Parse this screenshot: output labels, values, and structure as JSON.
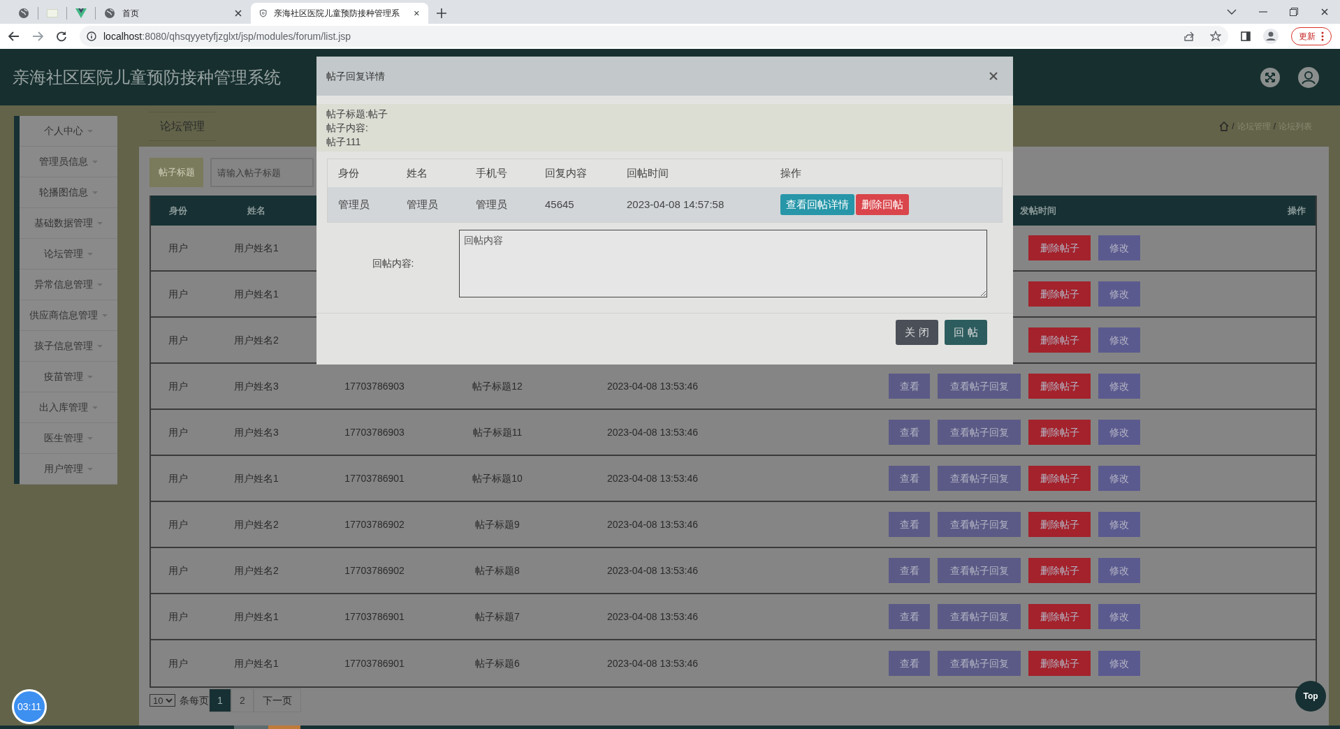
{
  "browser": {
    "tabs": [
      {
        "kind": "globe",
        "selected": false
      },
      {
        "kind": "blank",
        "selected": false
      },
      {
        "kind": "vue",
        "selected": false
      },
      {
        "kind": "globe",
        "label": "首页",
        "selected": false
      },
      {
        "kind": "shield",
        "label": "亲海社区医院儿童预防接种管理系",
        "selected": true
      }
    ],
    "url_host": "localhost",
    "url_rest": ":8080/qhsqyyetyfjzglxt/jsp/modules/forum/list.jsp",
    "update_button": "更新"
  },
  "app": {
    "title": "亲海社区医院儿童预防接种管理系统"
  },
  "sidebar": {
    "items": [
      {
        "label": "个人中心"
      },
      {
        "label": "管理员信息"
      },
      {
        "label": "轮播图信息"
      },
      {
        "label": "基础数据管理"
      },
      {
        "label": "论坛管理"
      },
      {
        "label": "异常信息管理"
      },
      {
        "label": "供应商信息管理"
      },
      {
        "label": "孩子信息管理"
      },
      {
        "label": "疫苗管理"
      },
      {
        "label": "出入库管理"
      },
      {
        "label": "医生管理"
      },
      {
        "label": "用户管理"
      }
    ]
  },
  "page_heading": "论坛管理",
  "breadcrumb": [
    {
      "separator": "/",
      "label": "论坛管理"
    },
    {
      "separator": "/",
      "label": "论坛列表"
    }
  ],
  "search": {
    "label": "帖子标题",
    "placeholder": "请输入帖子标题"
  },
  "table": {
    "columns": {
      "identity": "身份",
      "name": "姓名",
      "time": "发帖时间",
      "actions": "操作"
    },
    "rows": [
      {
        "identity": "用户",
        "name": "用户姓名1",
        "actions": [
          {
            "label": "删除帖子",
            "kind": "delete"
          },
          {
            "label": "修改",
            "kind": "edit"
          }
        ]
      },
      {
        "identity": "用户",
        "name": "用户姓名1",
        "actions": [
          {
            "label": "删除帖子",
            "kind": "delete"
          },
          {
            "label": "修改",
            "kind": "edit"
          }
        ]
      },
      {
        "identity": "用户",
        "name": "用户姓名2",
        "actions": [
          {
            "label": "删除帖子",
            "kind": "delete"
          },
          {
            "label": "修改",
            "kind": "edit"
          }
        ]
      },
      {
        "identity": "用户",
        "name": "用户姓名3",
        "phone": "17703786903",
        "title": "帖子标题12",
        "time": "2023-04-08 13:53:46",
        "actions": [
          {
            "label": "查看",
            "kind": "view"
          },
          {
            "label": "查看帖子回复",
            "kind": "replies"
          },
          {
            "label": "删除帖子",
            "kind": "delete"
          },
          {
            "label": "修改",
            "kind": "edit"
          }
        ]
      },
      {
        "identity": "用户",
        "name": "用户姓名3",
        "phone": "17703786903",
        "title": "帖子标题11",
        "time": "2023-04-08 13:53:46",
        "actions": [
          {
            "label": "查看",
            "kind": "view"
          },
          {
            "label": "查看帖子回复",
            "kind": "replies"
          },
          {
            "label": "删除帖子",
            "kind": "delete"
          },
          {
            "label": "修改",
            "kind": "edit"
          }
        ]
      },
      {
        "identity": "用户",
        "name": "用户姓名1",
        "phone": "17703786901",
        "title": "帖子标题10",
        "time": "2023-04-08 13:53:46",
        "actions": [
          {
            "label": "查看",
            "kind": "view"
          },
          {
            "label": "查看帖子回复",
            "kind": "replies"
          },
          {
            "label": "删除帖子",
            "kind": "delete"
          },
          {
            "label": "修改",
            "kind": "edit"
          }
        ]
      },
      {
        "identity": "用户",
        "name": "用户姓名2",
        "phone": "17703786902",
        "title": "帖子标题9",
        "time": "2023-04-08 13:53:46",
        "actions": [
          {
            "label": "查看",
            "kind": "view"
          },
          {
            "label": "查看帖子回复",
            "kind": "replies"
          },
          {
            "label": "删除帖子",
            "kind": "delete"
          },
          {
            "label": "修改",
            "kind": "edit"
          }
        ]
      },
      {
        "identity": "用户",
        "name": "用户姓名2",
        "phone": "17703786902",
        "title": "帖子标题8",
        "time": "2023-04-08 13:53:46",
        "actions": [
          {
            "label": "查看",
            "kind": "view"
          },
          {
            "label": "查看帖子回复",
            "kind": "replies"
          },
          {
            "label": "删除帖子",
            "kind": "delete"
          },
          {
            "label": "修改",
            "kind": "edit"
          }
        ]
      },
      {
        "identity": "用户",
        "name": "用户姓名1",
        "phone": "17703786901",
        "title": "帖子标题7",
        "time": "2023-04-08 13:53:46",
        "actions": [
          {
            "label": "查看",
            "kind": "view"
          },
          {
            "label": "查看帖子回复",
            "kind": "replies"
          },
          {
            "label": "删除帖子",
            "kind": "delete"
          },
          {
            "label": "修改",
            "kind": "edit"
          }
        ]
      },
      {
        "identity": "用户",
        "name": "用户姓名1",
        "phone": "17703786901",
        "title": "帖子标题6",
        "time": "2023-04-08 13:53:46",
        "actions": [
          {
            "label": "查看",
            "kind": "view"
          },
          {
            "label": "查看帖子回复",
            "kind": "replies"
          },
          {
            "label": "删除帖子",
            "kind": "delete"
          },
          {
            "label": "修改",
            "kind": "edit"
          }
        ]
      }
    ]
  },
  "pagination": {
    "page_size": "10",
    "page_size_label": "条每页",
    "pages": [
      {
        "label": "1",
        "selected": true
      },
      {
        "label": "2",
        "selected": false
      }
    ],
    "next": "下一页"
  },
  "clock": "03:11",
  "top_button": "Top",
  "modal": {
    "title": "帖子回复详情",
    "info": [
      "帖子标题:帖子",
      "帖子内容:",
      "帖子111"
    ],
    "reply_table": {
      "columns": [
        "身份",
        "姓名",
        "手机号",
        "回复内容",
        "回帖时间",
        "操作"
      ],
      "rows": [
        {
          "cells": [
            "管理员",
            "管理员",
            "管理员",
            "45645",
            "2023-04-08 14:57:58"
          ],
          "actions": [
            {
              "label": "查看回帖详情",
              "kind": "info"
            },
            {
              "label": "删除回帖",
              "kind": "danger"
            }
          ]
        }
      ]
    },
    "reply_label": "回帖内容:",
    "reply_placeholder": "回帖内容",
    "buttons": [
      {
        "label": "关 闭",
        "kind": "close"
      },
      {
        "label": "回 帖",
        "kind": "submit"
      }
    ]
  }
}
